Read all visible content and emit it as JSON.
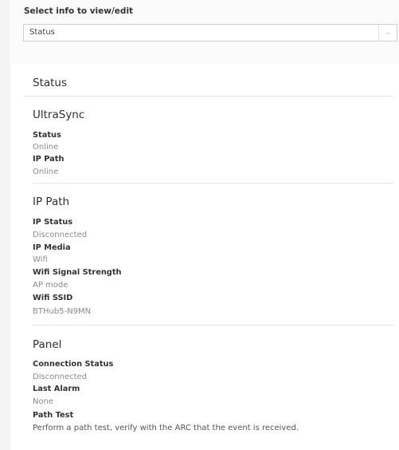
{
  "select": {
    "label": "Select info to view/edit",
    "value": "Status",
    "chevron": "⌄"
  },
  "main": {
    "title": "Status",
    "sections": {
      "ultrasync": {
        "title": "UltraSync",
        "fields": [
          {
            "label": "Status",
            "value": "Online"
          },
          {
            "label": "IP Path",
            "value": "Online"
          }
        ]
      },
      "ip_path": {
        "title": "IP Path",
        "fields": [
          {
            "label": "IP Status",
            "value": "Disconnected"
          },
          {
            "label": "IP Media",
            "value": "Wifi"
          },
          {
            "label": "Wifi Signal Strength",
            "value": "AP mode"
          },
          {
            "label": "Wifi SSID",
            "value": "BTHub5-N9MN"
          }
        ]
      },
      "panel": {
        "title": "Panel",
        "fields": [
          {
            "label": "Connection Status",
            "value": "Disconnected"
          },
          {
            "label": "Last Alarm",
            "value": "None"
          }
        ],
        "path_test": {
          "label": "Path Test",
          "description": "Perform a path test, verify with the ARC that the event is received."
        }
      }
    }
  }
}
